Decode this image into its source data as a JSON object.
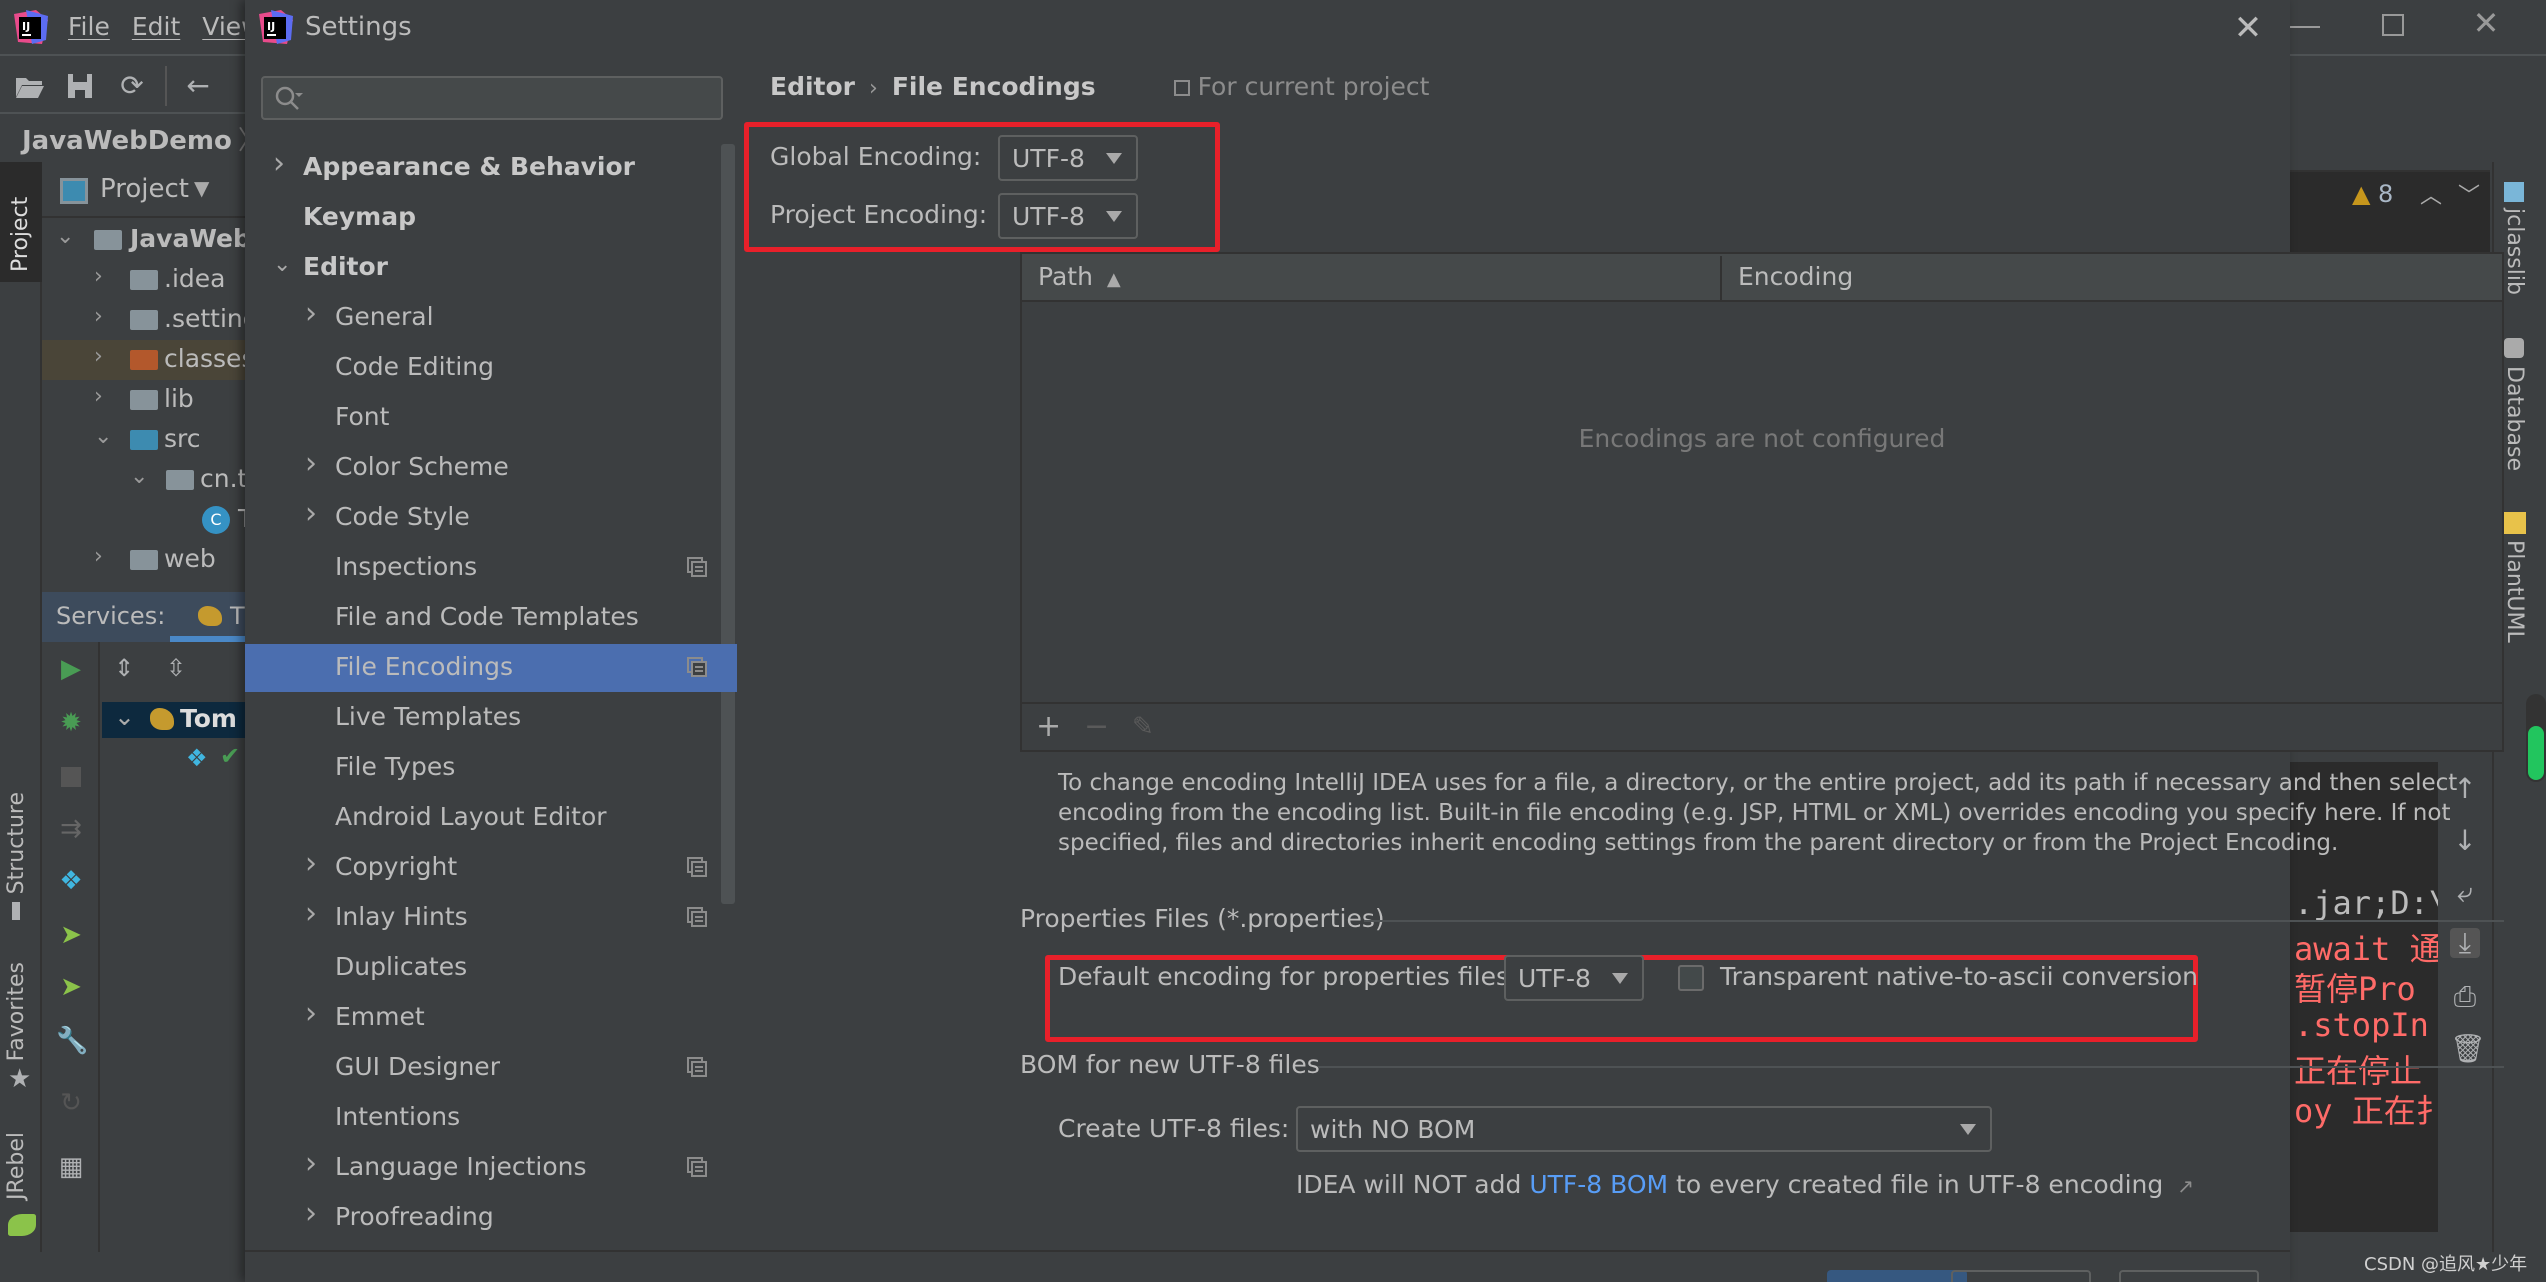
{
  "ide": {
    "menu": [
      "File",
      "Edit",
      "View"
    ],
    "breadcrumb": "JavaWebDemo",
    "project_panel": {
      "title": "Project",
      "tree": [
        {
          "label": "JavaWebDemo",
          "expanded": true,
          "level": 0
        },
        {
          "label": ".idea",
          "expanded": false,
          "level": 1
        },
        {
          "label": ".settings",
          "expanded": false,
          "level": 1
        },
        {
          "label": "classes",
          "expanded": false,
          "level": 1
        },
        {
          "label": "lib",
          "expanded": false,
          "level": 1
        },
        {
          "label": "src",
          "expanded": true,
          "level": 1
        },
        {
          "label": "cn.t",
          "expanded": true,
          "level": 2
        },
        {
          "label": "T",
          "level": 3
        },
        {
          "label": "web",
          "expanded": false,
          "level": 1
        }
      ]
    },
    "left_stripe": {
      "project": "Project",
      "structure": "Structure",
      "favorites": "Favorites",
      "jrebel": "JRebel"
    },
    "services": {
      "title": "Services:",
      "tab": "T",
      "node": "Tom"
    },
    "right_stripe": {
      "jclasslib": "jclasslib",
      "database": "Database",
      "plantuml": "PlantUML"
    },
    "warnings_count": "8",
    "console_lines": [
      {
        "text": ".jar;D:\\",
        "kind": "normal"
      },
      {
        "text": "await 通",
        "kind": "error"
      },
      {
        "text": " 暂停Pro",
        "kind": "error"
      },
      {
        "text": ".stopIn",
        "kind": "error"
      },
      {
        "text": "正在停止",
        "kind": "error"
      },
      {
        "text": "oy 正在扌",
        "kind": "error"
      }
    ],
    "watermark": "CSDN @追风★少年"
  },
  "dialog": {
    "title": "Settings",
    "search_placeholder": "",
    "tree": [
      {
        "label": "Appearance & Behavior",
        "level": 0,
        "bold": true,
        "chevron": "right"
      },
      {
        "label": "Keymap",
        "level": 0,
        "bold": true,
        "chevron": ""
      },
      {
        "label": "Editor",
        "level": 0,
        "bold": true,
        "chevron": "down"
      },
      {
        "label": "General",
        "level": 1,
        "chevron": "right"
      },
      {
        "label": "Code Editing",
        "level": 1,
        "chevron": ""
      },
      {
        "label": "Font",
        "level": 1,
        "chevron": ""
      },
      {
        "label": "Color Scheme",
        "level": 1,
        "chevron": "right"
      },
      {
        "label": "Code Style",
        "level": 1,
        "chevron": "right"
      },
      {
        "label": "Inspections",
        "level": 1,
        "chevron": "",
        "project_icon": true
      },
      {
        "label": "File and Code Templates",
        "level": 1,
        "chevron": ""
      },
      {
        "label": "File Encodings",
        "level": 1,
        "chevron": "",
        "project_icon": true,
        "selected": true
      },
      {
        "label": "Live Templates",
        "level": 1,
        "chevron": ""
      },
      {
        "label": "File Types",
        "level": 1,
        "chevron": ""
      },
      {
        "label": "Android Layout Editor",
        "level": 1,
        "chevron": ""
      },
      {
        "label": "Copyright",
        "level": 1,
        "chevron": "right",
        "project_icon": true
      },
      {
        "label": "Inlay Hints",
        "level": 1,
        "chevron": "right",
        "project_icon": true
      },
      {
        "label": "Duplicates",
        "level": 1,
        "chevron": ""
      },
      {
        "label": "Emmet",
        "level": 1,
        "chevron": "right"
      },
      {
        "label": "GUI Designer",
        "level": 1,
        "chevron": "",
        "project_icon": true
      },
      {
        "label": "Intentions",
        "level": 1,
        "chevron": ""
      },
      {
        "label": "Language Injections",
        "level": 1,
        "chevron": "right",
        "project_icon": true
      },
      {
        "label": "Proofreading",
        "level": 1,
        "chevron": "right"
      }
    ],
    "content": {
      "breadcrumb": {
        "parent": "Editor",
        "separator": "›",
        "current": "File Encodings",
        "scope": "For current project"
      },
      "global_encoding": {
        "label": "Global Encoding:",
        "value": "UTF-8"
      },
      "project_encoding": {
        "label": "Project Encoding:",
        "value": "UTF-8"
      },
      "table": {
        "columns": [
          "Path",
          "Encoding"
        ],
        "sort_indicator": "▲",
        "empty_text": "Encodings are not configured",
        "rows": []
      },
      "description": "To change encoding IntelliJ IDEA uses for a file, a directory, or the entire project, add its path if necessary and then select encoding from the encoding list. Built-in file encoding (e.g. JSP, HTML or XML) overrides encoding you specify here. If not specified, files and directories inherit encoding settings from the parent directory or from the Project Encoding.",
      "properties_section": {
        "title": "Properties Files (*.properties)",
        "default_label": "Default encoding for properties files:",
        "default_value": "UTF-8",
        "transparent_label": "Transparent native-to-ascii conversion",
        "transparent_checked": false
      },
      "bom_section": {
        "title": "BOM for new UTF-8 files",
        "create_label": "Create UTF-8 files:",
        "create_value": "with NO BOM",
        "info_prefix": "IDEA will NOT add ",
        "info_link": "UTF-8 BOM",
        "info_suffix": " to every created file in UTF-8 encoding",
        "info_arrow": "↗"
      }
    }
  },
  "colors": {
    "background": "#3c3f41",
    "selection": "#4b6eaf",
    "highlight_box": "#e8202a",
    "link": "#589df6",
    "console_error": "#ff6b68",
    "warning": "#c6961c"
  }
}
